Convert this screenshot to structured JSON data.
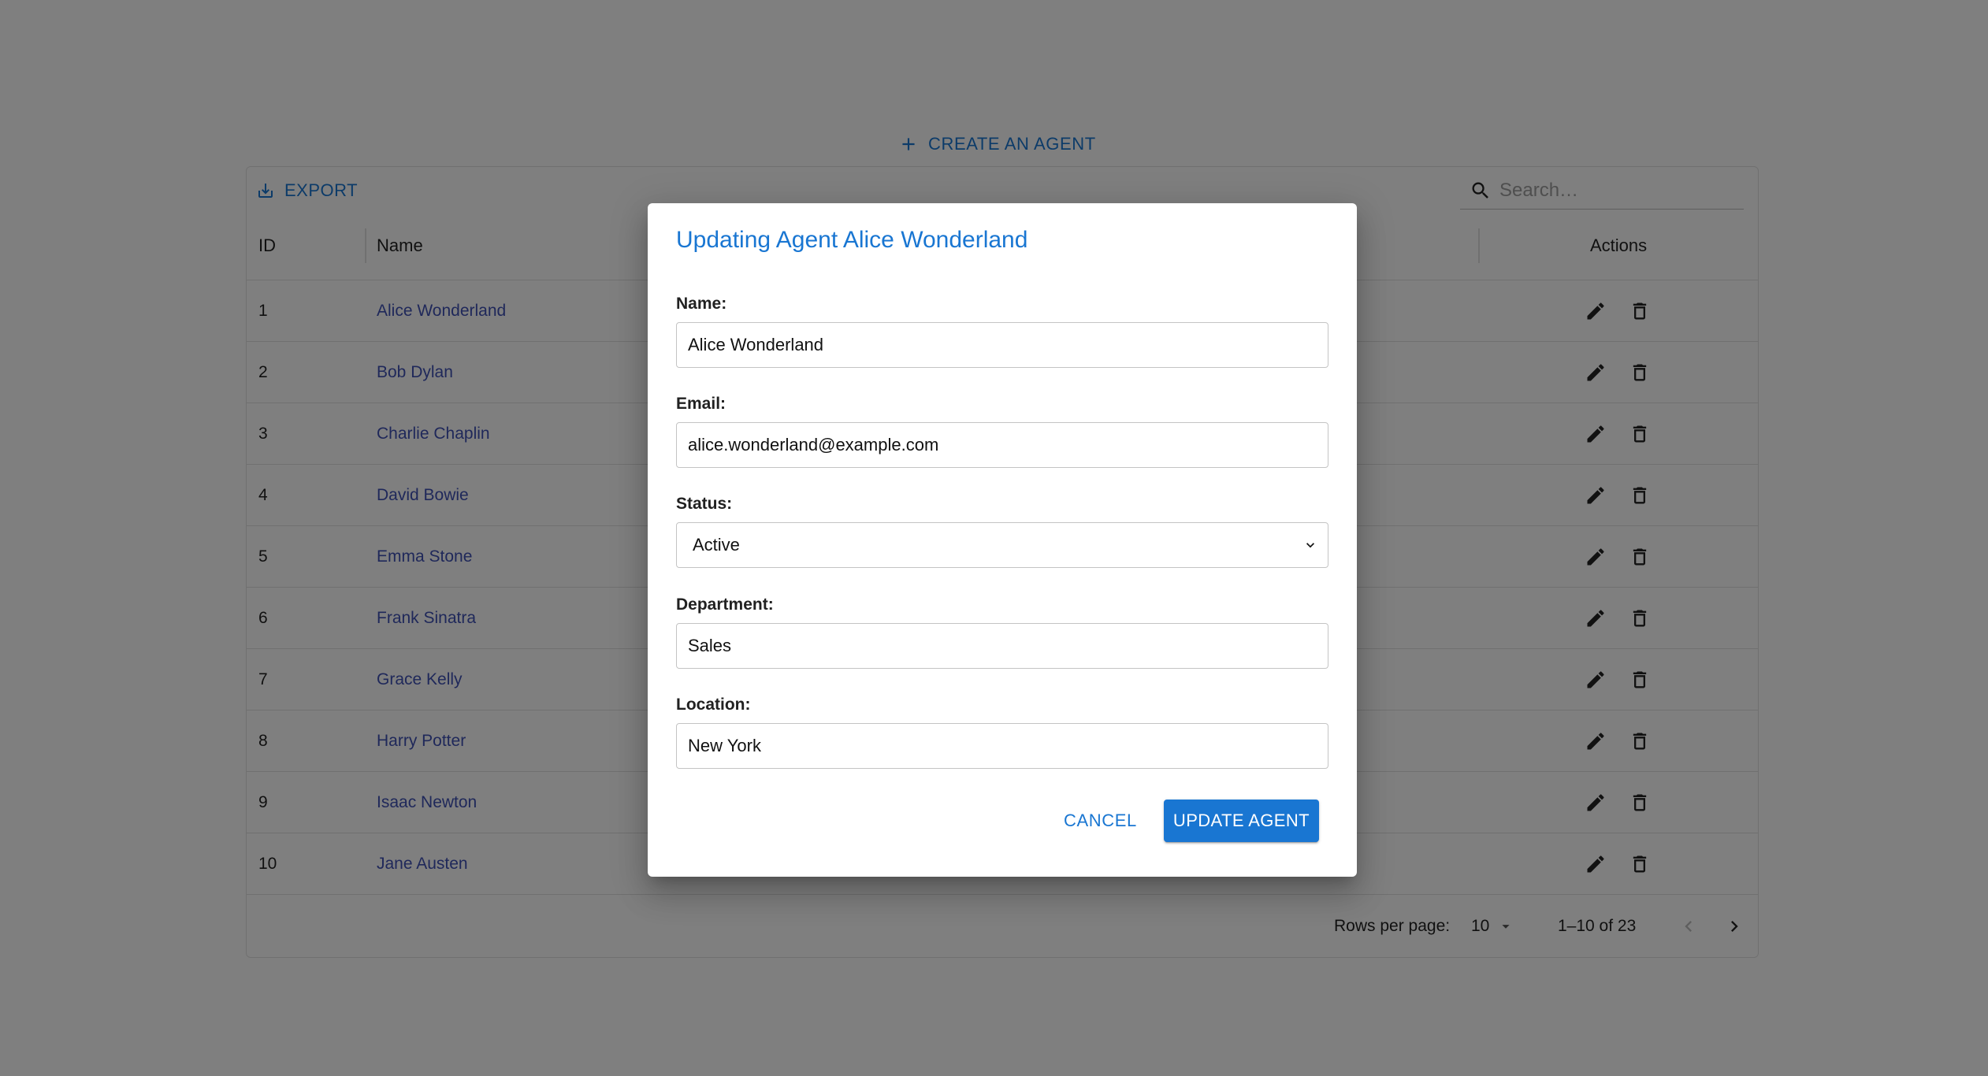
{
  "create_button": {
    "label": "CREATE AN AGENT",
    "icon": "plus-icon"
  },
  "grid": {
    "toolbar": {
      "export_label": "EXPORT",
      "search_placeholder": "Search…"
    },
    "columns": {
      "id": "ID",
      "name": "Name",
      "actions": "Actions"
    },
    "rows": [
      {
        "id": "1",
        "name": "Alice Wonderland"
      },
      {
        "id": "2",
        "name": "Bob Dylan"
      },
      {
        "id": "3",
        "name": "Charlie Chaplin"
      },
      {
        "id": "4",
        "name": "David Bowie"
      },
      {
        "id": "5",
        "name": "Emma Stone"
      },
      {
        "id": "6",
        "name": "Frank Sinatra"
      },
      {
        "id": "7",
        "name": "Grace Kelly"
      },
      {
        "id": "8",
        "name": "Harry Potter"
      },
      {
        "id": "9",
        "name": "Isaac Newton"
      },
      {
        "id": "10",
        "name": "Jane Austen"
      }
    ],
    "footer": {
      "rows_per_page_label": "Rows per page:",
      "rows_per_page_value": "10",
      "range": "1–10 of 23"
    }
  },
  "dialog": {
    "title": "Updating Agent Alice Wonderland",
    "fields": {
      "name": {
        "label": "Name:",
        "value": "Alice Wonderland"
      },
      "email": {
        "label": "Email:",
        "value": "alice.wonderland@example.com"
      },
      "status": {
        "label": "Status:",
        "value": "Active"
      },
      "department": {
        "label": "Department:",
        "value": "Sales"
      },
      "location": {
        "label": "Location:",
        "value": "New York"
      }
    },
    "cancel_label": "CANCEL",
    "update_label": "UPDATE AGENT"
  },
  "colors": {
    "primary": "#1976d2",
    "link": "#3f51b5",
    "overlay": "rgba(0,0,0,0.5)"
  }
}
